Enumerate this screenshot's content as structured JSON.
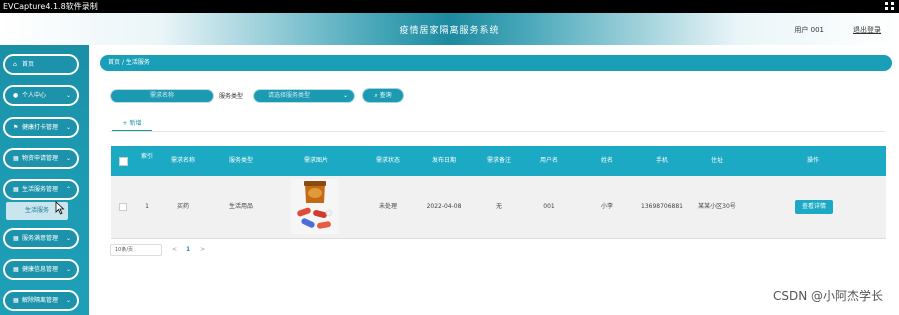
{
  "window": {
    "app_title": "EVCapture4.1.8软件录制"
  },
  "header": {
    "system_title": "疫情居家隔离服务系统",
    "user": "用户 001",
    "logout": "退出登录"
  },
  "sidebar": {
    "items": [
      {
        "label": "首页",
        "icon": "home-icon"
      },
      {
        "label": "个人中心",
        "icon": "person-icon"
      },
      {
        "label": "健康打卡管理",
        "icon": "flag-icon"
      },
      {
        "label": "物资申请管理",
        "icon": "grid-icon"
      },
      {
        "label": "生活服务管理",
        "icon": "grid-icon"
      },
      {
        "label": "服务满意管理",
        "icon": "grid-icon"
      },
      {
        "label": "健康信息管理",
        "icon": "grid-icon"
      },
      {
        "label": "解除隔离管理",
        "icon": "grid-icon"
      }
    ],
    "active_sub": "生活服务"
  },
  "breadcrumb": {
    "home": "首页",
    "separator": "/",
    "current": "生活服务"
  },
  "search": {
    "name_placeholder": "需求名称",
    "type_label": "服务类型",
    "type_placeholder": "请选择服务类型",
    "query_label": "查询"
  },
  "tabs": {
    "add_label": "+ 新增"
  },
  "table": {
    "headers": [
      "",
      "索引",
      "需求名称",
      "服务类型",
      "需求图片",
      "需求状态",
      "发布日期",
      "需求备注",
      "用户名",
      "姓名",
      "手机",
      "住址",
      "操作"
    ],
    "rows": [
      {
        "index": "1",
        "name": "买药",
        "type": "生活用品",
        "status": "未处理",
        "date": "2022-04-08",
        "remark": "无",
        "username": "001",
        "realname": "小李",
        "phone": "13698706881",
        "address": "某某小区30号",
        "action": "查看详情"
      }
    ]
  },
  "pager": {
    "page_size": "10条/页",
    "prev": "<",
    "current": "1",
    "next": ">"
  },
  "watermark": "CSDN @小阿杰学长",
  "colors": {
    "accent": "#1ba9c3",
    "sidebar": "#1c93aa"
  }
}
